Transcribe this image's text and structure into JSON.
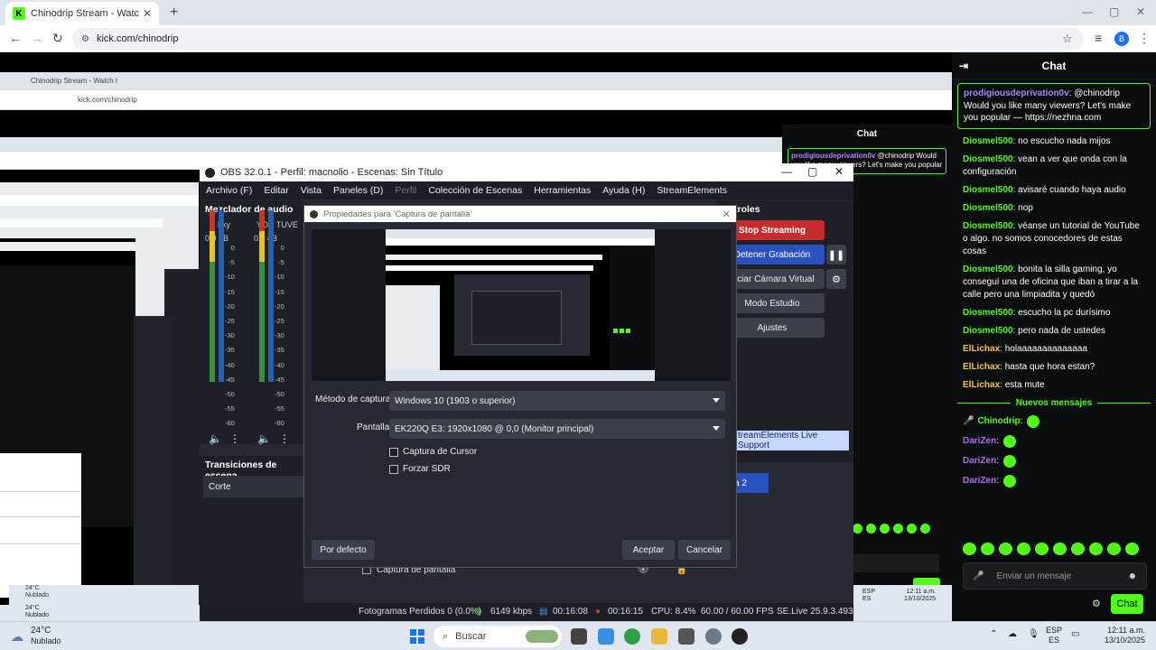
{
  "browser": {
    "tab_title": "Chinodrip Stream - Watch l",
    "tab_favicon": "K",
    "url": "kick.com/chinodrip",
    "profile_initial": "B"
  },
  "nested": {
    "tab_title": "Chinodrip Stream - Watch l",
    "url": "kick.com/chinodrip",
    "chat_title": "Chat",
    "pinned_user": "prodigiousdeprivation0v",
    "pinned_text": "@chinodrip Would you like many viewers? Let's make you popular",
    "weather1_temp": "24°C",
    "weather1_desc": "Nublado",
    "weather2_temp": "24°C",
    "weather2_desc": "Nublado",
    "lang": "ESP",
    "lang2": "ES",
    "time": "12:11 a.m.",
    "date": "13/10/2025"
  },
  "chat": {
    "title": "Chat",
    "pinned": {
      "user": "prodigiousdeprivation0v",
      "text": ": @chinodrip Would you like many viewers? Let's make you popular — https://nezhna.com"
    },
    "messages": [
      {
        "user": "Diosmel500",
        "text": ": no escucho nada mijos",
        "cls": "u-d"
      },
      {
        "user": "Diosmel500",
        "text": ": vean a ver que onda con la configuración",
        "cls": "u-d"
      },
      {
        "user": "Diosmel500",
        "text": ": avisaré cuando haya audio",
        "cls": "u-d"
      },
      {
        "user": "Diosmel500",
        "text": ": nop",
        "cls": "u-d"
      },
      {
        "user": "Diosmel500",
        "text": ": véanse un tutorial de YouTube o algo. no somos conocedores de estas cosas",
        "cls": "u-d"
      },
      {
        "user": "Diosmel500",
        "text": ": bonita la silla gaming, yo conseguí una de oficina que iban a tirar a la calle pero una limpiadita y quedó",
        "cls": "u-d"
      },
      {
        "user": "Diosmel500",
        "text": ": escucho la pc durísimo",
        "cls": "u-d"
      },
      {
        "user": "Diosmel500",
        "text": ": pero nada de ustedes",
        "cls": "u-d"
      },
      {
        "user": "ElLichax",
        "text": ": holaaaaaaaaaaaaaa",
        "cls": "u-e"
      },
      {
        "user": "ElLichax",
        "text": ": hasta que hora estan?",
        "cls": "u-e"
      },
      {
        "user": "ElLichax",
        "text": ": esta mute",
        "cls": "u-e"
      }
    ],
    "new_messages_label": "Nuevos mensajes",
    "new_messages": [
      {
        "user": "Chinodrip",
        "text": ":",
        "cls": "u-c"
      },
      {
        "user": "DariZen",
        "text": ":",
        "cls": "u-z"
      },
      {
        "user": "DariZen",
        "text": ":",
        "cls": "u-z"
      },
      {
        "user": "DariZen",
        "text": ":",
        "cls": "u-z"
      }
    ],
    "input_placeholder": "Enviar un mensaje",
    "send_label": "Chat"
  },
  "obs": {
    "title": "OBS 32.0.1 - Perfil: macnolio - Escenas: Sin Título",
    "menu": [
      "Archivo (F)",
      "Editar",
      "Vista",
      "Paneles (D)",
      "Perfil",
      "Colección de Escenas",
      "Herramientas",
      "Ayuda (H)",
      "StreamElements"
    ],
    "mixer_title": "Mezclador de audio",
    "channel1": "hky",
    "channel2": "YOU TUVE",
    "db1": "0.0 dB",
    "db2": "0.0 dB",
    "scale": [
      "0",
      "-5",
      "-10",
      "-15",
      "-20",
      "-25",
      "-30",
      "-35",
      "-40",
      "-45",
      "-50",
      "-55",
      "-60"
    ],
    "transitions_title": "Transiciones de escena",
    "transition": "Corte",
    "controls_title": "troles",
    "stop_streaming": "Stop Streaming",
    "stop_recording": "Detener Grabación",
    "virtual_cam": "niciar Cámara Virtual",
    "studio_mode": "Modo Estudio",
    "settings": "Ajustes",
    "se_support": "treamElements Live Support",
    "scene2": "a 2",
    "source": "Captura de pantalla",
    "status": {
      "dropped": "Fotogramas Perdidos 0 (0.0%)",
      "kbps": "6149 kbps",
      "stream_time": "00:16:08",
      "rec_time": "00:16:15",
      "cpu": "CPU: 8.4%",
      "fps": "60.00 / 60.00 FPS",
      "se": "SE.Live 25.9.3.493"
    }
  },
  "dialog": {
    "title": "Propiedades para 'Captura de pantalla'",
    "method_label": "Método de captura",
    "method_value": "Windows 10 (1903 o superior)",
    "screen_label": "Pantalla",
    "screen_value": "EK220Q E3: 1920x1080 @ 0,0 (Monitor principal)",
    "cursor_label": "Captura de Cursor",
    "sdr_label": "Forzar SDR",
    "default_btn": "Por defecto",
    "accept_btn": "Aceptar",
    "cancel_btn": "Cancelar"
  },
  "taskbar": {
    "temp": "24°C",
    "weather": "Nublado",
    "search": "Buscar",
    "lang": "ESP",
    "lang2": "ES",
    "time": "12:11 a.m.",
    "date": "13/10/2025"
  }
}
